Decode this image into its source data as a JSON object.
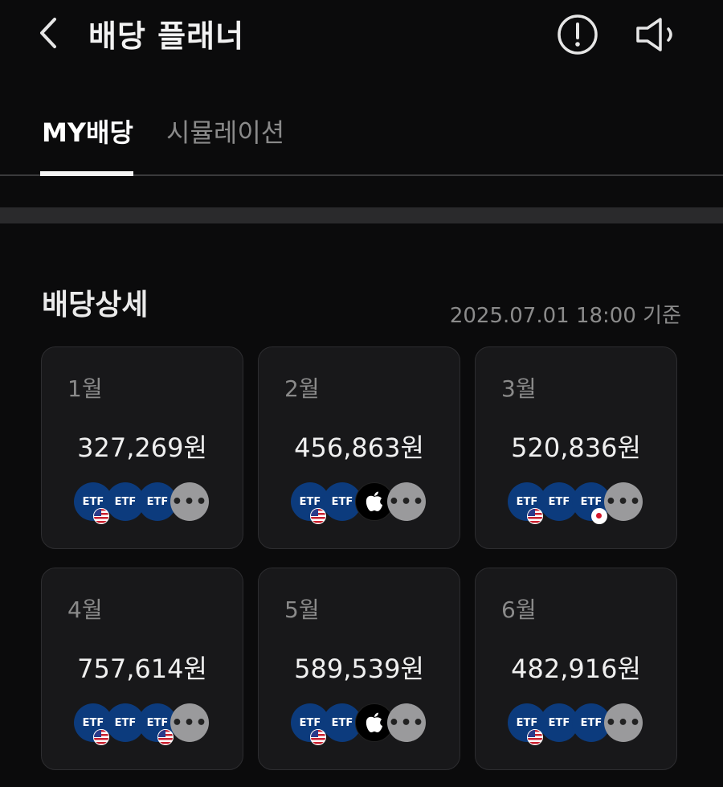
{
  "header": {
    "title": "배당 플래너"
  },
  "tabs": [
    {
      "label": "MY배당",
      "active": true
    },
    {
      "label": "시뮬레이션",
      "active": false
    }
  ],
  "section": {
    "title": "배당상세",
    "timestamp": "2025.07.01 18:00 기준"
  },
  "months": [
    {
      "month": "1월",
      "amount": "327,269원",
      "icons": [
        {
          "type": "etf",
          "label": "ETF",
          "flag": "us"
        },
        {
          "type": "etf",
          "label": "ETF",
          "flag": ""
        },
        {
          "type": "etf",
          "label": "ETF",
          "flag": ""
        },
        {
          "type": "more",
          "label": "•••"
        }
      ]
    },
    {
      "month": "2월",
      "amount": "456,863원",
      "icons": [
        {
          "type": "etf",
          "label": "ETF",
          "flag": "us"
        },
        {
          "type": "etf",
          "label": "ETF",
          "flag": ""
        },
        {
          "type": "apple",
          "label": ""
        },
        {
          "type": "more",
          "label": "•••"
        }
      ]
    },
    {
      "month": "3월",
      "amount": "520,836원",
      "icons": [
        {
          "type": "etf",
          "label": "ETF",
          "flag": "us"
        },
        {
          "type": "etf",
          "label": "ETF",
          "flag": ""
        },
        {
          "type": "etf",
          "label": "ETF",
          "flag": "jp"
        },
        {
          "type": "more",
          "label": "•••"
        }
      ]
    },
    {
      "month": "4월",
      "amount": "757,614원",
      "icons": [
        {
          "type": "etf",
          "label": "ETF",
          "flag": "us"
        },
        {
          "type": "etf",
          "label": "ETF",
          "flag": ""
        },
        {
          "type": "etf",
          "label": "ETF",
          "flag": "us"
        },
        {
          "type": "more",
          "label": "•••"
        }
      ]
    },
    {
      "month": "5월",
      "amount": "589,539원",
      "icons": [
        {
          "type": "etf",
          "label": "ETF",
          "flag": "us"
        },
        {
          "type": "etf",
          "label": "ETF",
          "flag": ""
        },
        {
          "type": "apple",
          "label": ""
        },
        {
          "type": "more",
          "label": "•••"
        }
      ]
    },
    {
      "month": "6월",
      "amount": "482,916원",
      "icons": [
        {
          "type": "etf",
          "label": "ETF",
          "flag": "us"
        },
        {
          "type": "etf",
          "label": "ETF",
          "flag": ""
        },
        {
          "type": "etf",
          "label": "ETF",
          "flag": ""
        },
        {
          "type": "more",
          "label": "•••"
        }
      ]
    }
  ]
}
